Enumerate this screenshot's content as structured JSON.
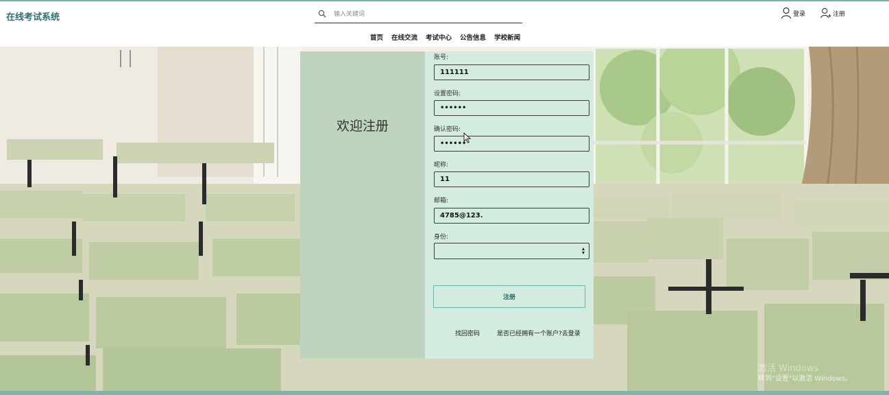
{
  "app": {
    "title": "在线考试系统"
  },
  "search": {
    "placeholder": "输入关键词",
    "icon": "search-icon"
  },
  "auth": {
    "login_label": "登录",
    "register_label": "注册"
  },
  "nav": {
    "items": [
      "首页",
      "在线交流",
      "考试中心",
      "公告信息",
      "学校新闻"
    ]
  },
  "form": {
    "welcome": "欢迎注册",
    "account_label": "账号:",
    "account_value": "111111",
    "password_label": "设置密码:",
    "password_value": "••••••",
    "confirm_label": "确认密码:",
    "confirm_value": "••••••",
    "nickname_label": "昵称:",
    "nickname_value": "11",
    "email_label": "邮箱:",
    "email_value": "4785@123.",
    "role_label": "身份:",
    "role_value": "",
    "submit_label": "注册",
    "forgot_label": "找回密码",
    "have_account_label": "是否已经拥有一个账户?去登录"
  },
  "watermark": {
    "line1": "激活 Windows",
    "line2": "转到\"设置\"以激活 Windows。"
  },
  "colors": {
    "accent": "#6fb3a9",
    "card_left": "#bed4bf",
    "card_right": "#d3ecdf",
    "brand": "#2f6f73"
  }
}
